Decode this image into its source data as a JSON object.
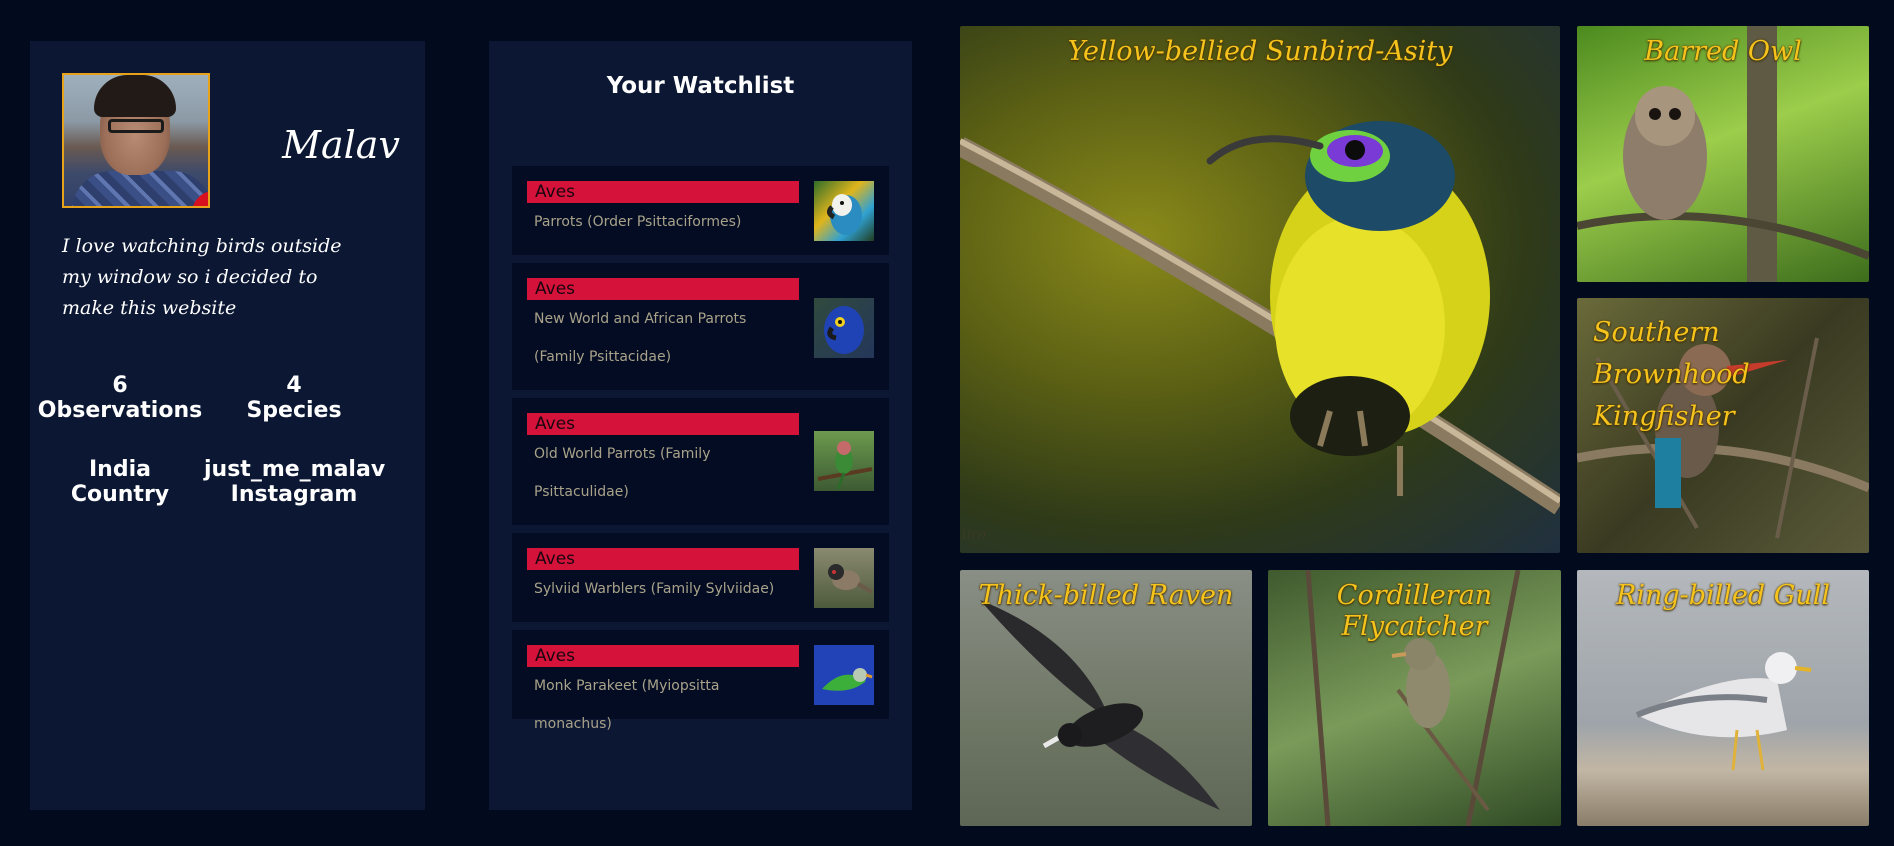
{
  "profile": {
    "username": "Malav",
    "bio": "I love watching birds outside my window so i decided to make this website",
    "observations_count": "6",
    "observations_label": "Observations",
    "species_count": "4",
    "species_label": "Species",
    "country_value": "India",
    "country_label": "Country",
    "instagram_value": "just_me_malav",
    "instagram_label": "Instagram"
  },
  "watchlist": {
    "title": "Your Watchlist",
    "items": [
      {
        "tag": "Aves",
        "name": "Parrots (Order Psittaciformes)"
      },
      {
        "tag": "Aves",
        "name": "New World and African Parrots (Family Psittacidae)"
      },
      {
        "tag": "Aves",
        "name": "Old World Parrots (Family Psittaculidae)"
      },
      {
        "tag": "Aves",
        "name": "Sylviid Warblers (Family Sylviidae)"
      },
      {
        "tag": "Aves",
        "name": "Monk Parakeet (Myiopsitta monachus)"
      }
    ]
  },
  "gallery": {
    "tiles": [
      {
        "title": "Yellow-bellied Sunbird-Asity"
      },
      {
        "title": "Barred Owl"
      },
      {
        "title": "Southern Brownhood Kingfisher"
      },
      {
        "title": "Thick-billed Raven"
      },
      {
        "title": "Cordilleran Flycatcher"
      },
      {
        "title": "Ring-billed Gull"
      }
    ],
    "watermark": "iiro"
  },
  "colors": {
    "page_bg": "#020b1e",
    "panel_bg": "#0b1733",
    "tag_red": "#d4123a",
    "title_yellow": "#f6c31d",
    "edit_red": "#d7101f"
  },
  "icons": {
    "edit": "pencil-icon"
  }
}
